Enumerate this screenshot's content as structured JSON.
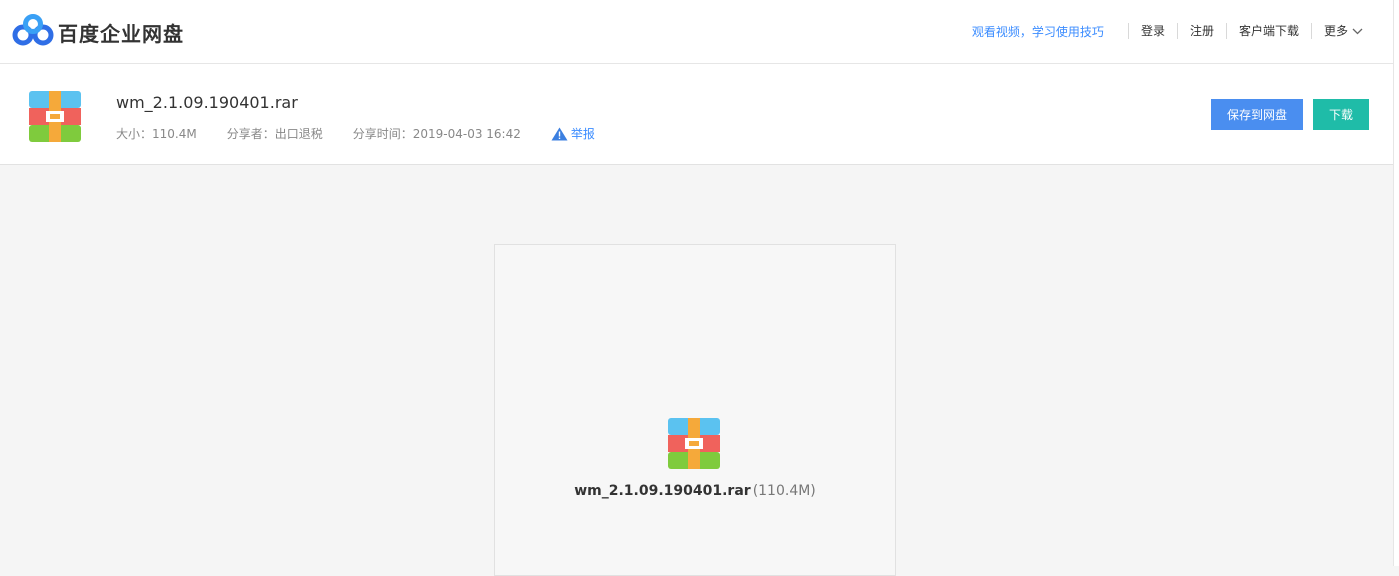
{
  "header": {
    "brand": "百度企业网盘",
    "tip_link": "观看视频，学习使用技巧",
    "login": "登录",
    "register": "注册",
    "client_download": "客户端下载",
    "more": "更多"
  },
  "file": {
    "name": "wm_2.1.09.190401.rar",
    "size_label": "大小：110.4M",
    "sharer_label": "分享者：出口退税",
    "share_time_label": "分享时间：2019-04-03 16:42",
    "report": "举报",
    "save_button": "保存到网盘",
    "download_button": "下载"
  },
  "preview": {
    "name": "wm_2.1.09.190401.rar",
    "size": "(110.4M)"
  },
  "colors": {
    "accent_blue": "#3b8cff",
    "save_button": "#4a8ef0",
    "download_button": "#1fbca8"
  }
}
